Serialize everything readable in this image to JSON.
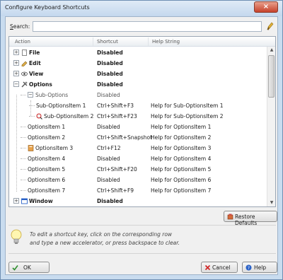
{
  "window": {
    "title": "Configure Keyboard Shortcuts",
    "close_glyph": "×"
  },
  "search": {
    "label_acc": "S",
    "label_rest": "earch:",
    "value": "",
    "placeholder": ""
  },
  "columns": {
    "action": "Action",
    "shortcut": "Shortcut",
    "help": "Help String"
  },
  "rows": [
    {
      "level": 0,
      "expander": "⊞",
      "icon": "file-icon",
      "action": "File",
      "shortcut": "Disabled",
      "help": "",
      "bold": true
    },
    {
      "level": 0,
      "expander": "⊞",
      "icon": "edit-icon",
      "action": "Edit",
      "shortcut": "Disabled",
      "help": "",
      "bold": true
    },
    {
      "level": 0,
      "expander": "⊞",
      "icon": "view-icon",
      "action": "View",
      "shortcut": "Disabled",
      "help": "",
      "bold": true
    },
    {
      "level": 0,
      "expander": "⊟",
      "icon": "options-icon",
      "action": "Options",
      "shortcut": "Disabled",
      "help": "",
      "bold": true
    },
    {
      "level": 1,
      "expander": "⊟",
      "icon": "",
      "action": "Sub-Options",
      "shortcut": "Disabled",
      "help": "",
      "bold": false,
      "muted": true
    },
    {
      "level": 2,
      "expander": "",
      "icon": "",
      "action": "Sub-OptionsItem 1",
      "shortcut": "Ctrl+Shift+F3",
      "help": "Help for Sub-OptionsItem 1",
      "bold": false
    },
    {
      "level": 2,
      "expander": "",
      "icon": "sub-options-item-icon",
      "action": "Sub-OptionsItem 2",
      "shortcut": "Ctrl+Shift+F23",
      "help": "Help for Sub-OptionsItem 2",
      "bold": false
    },
    {
      "level": 1,
      "expander": "",
      "icon": "",
      "action": "OptionsItem 1",
      "shortcut": "Disabled",
      "help": "Help for OptionsItem 1",
      "bold": false
    },
    {
      "level": 1,
      "expander": "",
      "icon": "",
      "action": "OptionsItem 2",
      "shortcut": "Ctrl+Shift+Snapshot",
      "help": "Help for OptionsItem 2",
      "bold": false
    },
    {
      "level": 1,
      "expander": "",
      "icon": "options-item-icon",
      "action": "OptionsItem 3",
      "shortcut": "Ctrl+F12",
      "help": "Help for OptionsItem 3",
      "bold": false
    },
    {
      "level": 1,
      "expander": "",
      "icon": "",
      "action": "OptionsItem 4",
      "shortcut": "Disabled",
      "help": "Help for OptionsItem 4",
      "bold": false
    },
    {
      "level": 1,
      "expander": "",
      "icon": "",
      "action": "OptionsItem 5",
      "shortcut": "Ctrl+Shift+F20",
      "help": "Help for OptionsItem 5",
      "bold": false
    },
    {
      "level": 1,
      "expander": "",
      "icon": "",
      "action": "OptionsItem 6",
      "shortcut": "Disabled",
      "help": "Help for OptionsItem 6",
      "bold": false
    },
    {
      "level": 1,
      "expander": "",
      "icon": "",
      "action": "OptionsItem 7",
      "shortcut": "Ctrl+Shift+F9",
      "help": "Help for OptionsItem 7",
      "bold": false
    },
    {
      "level": 0,
      "expander": "⊞",
      "icon": "window-icon",
      "action": "Window",
      "shortcut": "Disabled",
      "help": "",
      "bold": true
    }
  ],
  "buttons": {
    "restore_defaults": "Restore Defaults",
    "ok": "OK",
    "cancel": "Cancel",
    "help": "Help"
  },
  "hint": {
    "line1": "To edit a shortcut key, click on the corresponding row",
    "line2": "and type a new accelerator, or press backspace to clear."
  }
}
